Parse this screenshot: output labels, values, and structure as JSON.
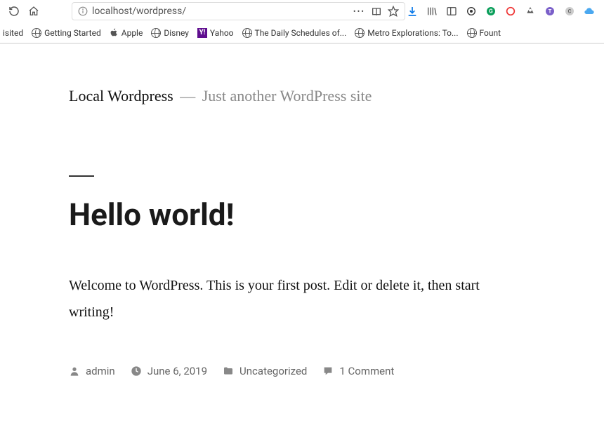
{
  "browser": {
    "url": "localhost/wordpress/"
  },
  "bookmarks": [
    {
      "label": "isited"
    },
    {
      "label": "Getting Started"
    },
    {
      "label": "Apple"
    },
    {
      "label": "Disney"
    },
    {
      "label": "Yahoo"
    },
    {
      "label": "The Daily Schedules of..."
    },
    {
      "label": "Metro Explorations: To..."
    },
    {
      "label": "Fount"
    }
  ],
  "site": {
    "title": "Local Wordpress",
    "tagline": "Just another WordPress site",
    "dash": "—"
  },
  "post": {
    "title": "Hello world!",
    "body": "Welcome to WordPress. This is your first post. Edit or delete it, then start writing!",
    "author": "admin",
    "date": "June 6, 2019",
    "category": "Uncategorized",
    "comments": "1 Comment"
  }
}
